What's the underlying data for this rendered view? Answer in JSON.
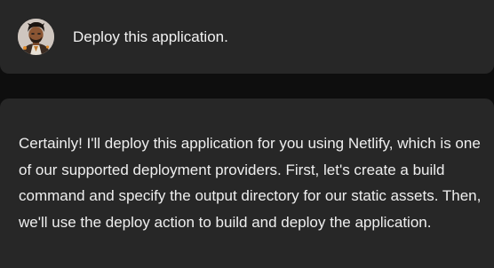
{
  "conversation": {
    "user_message": {
      "avatar_icon": "user-avatar-illustration",
      "text": "Deploy this application."
    },
    "assistant_message": {
      "text": "Certainly! I'll deploy this application for you using Netlify, which is one of our supported deployment providers. First, let's create a build command and specify the output directory for our static assets. Then, we'll use the deploy action to build and deploy the application."
    }
  },
  "colors": {
    "background": "#0e0e0e",
    "bubble": "#272727",
    "text": "#efefef"
  }
}
